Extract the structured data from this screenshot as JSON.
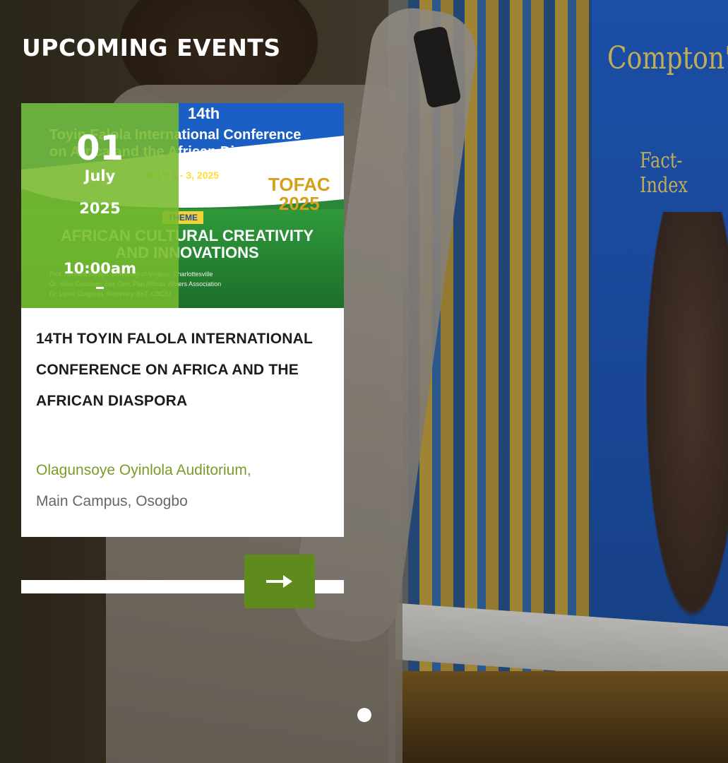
{
  "section": {
    "title": "UPCOMING EVENTS"
  },
  "event": {
    "day": "01",
    "month": "July",
    "year": "2025",
    "time": "10:00am",
    "title": "14TH TOYIN FALOLA INTERNATIONAL CONFERENCE ON AFRICA AND THE AFRICAN DIASPORA",
    "venue": "Olagunsoye Oyinlola Auditorium,",
    "location": "Main Campus, Osogbo"
  },
  "poster": {
    "sup": "14th",
    "line1": "Toyin Falola International Conference",
    "line2": "on Africa and the African Diaspora",
    "dates": "JULY 1 - 3, 2025",
    "tofac": "TOFAC",
    "tofac_year": "2025",
    "theme_tag": "THEME",
    "theme": "AFRICAN CULTURAL CREATIVITY AND INNOVATIONS",
    "fine1": "Prof. Nemata Blyden, University of Virginia, Charlottesville",
    "fine2": "Dr. Wale Okediran, Sec Gen, Pan African Writers Association",
    "fine3": "Dr. Lasisi Olagunju, Secretary, BoT, CBCIU"
  },
  "background": {
    "spine_title": "Compton's",
    "spine_sub": "Fact-Index"
  },
  "colors": {
    "accent_green": "#5e8a1e",
    "date_overlay": "#76ba2e",
    "venue_text": "#7c9a2a"
  },
  "icons": {
    "next": "arrow-right-icon"
  }
}
